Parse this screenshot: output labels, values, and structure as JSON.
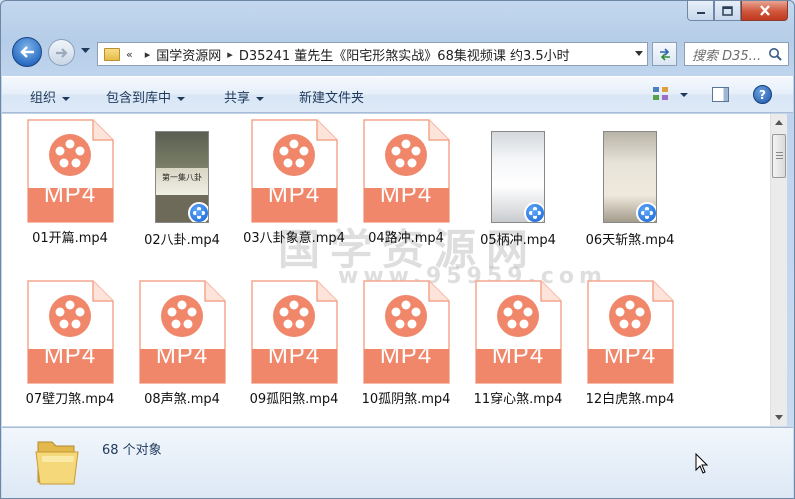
{
  "window": {
    "caption_buttons": [
      "minimize",
      "maximize",
      "close"
    ]
  },
  "address_bar": {
    "overflow": "«",
    "segments": [
      "国学资源网",
      "D35241 董先生《阳宅形煞实战》68集视频课 约3.5小时"
    ],
    "search_placeholder": "搜索 D35..."
  },
  "commands": {
    "organize": "组织",
    "include_library": "包含到库中",
    "share": "共享",
    "new_folder": "新建文件夹"
  },
  "files": [
    {
      "name": "01开篇.mp4",
      "kind": "mp4-icon"
    },
    {
      "name": "02八卦.mp4",
      "kind": "thumbnail",
      "thumb_text": "第一集八卦"
    },
    {
      "name": "03八卦象意.mp4",
      "kind": "mp4-icon"
    },
    {
      "name": "04路冲.mp4",
      "kind": "mp4-icon"
    },
    {
      "name": "05柄冲.mp4",
      "kind": "thumbnail"
    },
    {
      "name": "06天斩煞.mp4",
      "kind": "thumbnail"
    },
    {
      "name": "07壁刀煞.mp4",
      "kind": "mp4-icon"
    },
    {
      "name": "08声煞.mp4",
      "kind": "mp4-icon"
    },
    {
      "name": "09孤阳煞.mp4",
      "kind": "mp4-icon"
    },
    {
      "name": "10孤阴煞.mp4",
      "kind": "mp4-icon"
    },
    {
      "name": "11穿心煞.mp4",
      "kind": "mp4-icon"
    },
    {
      "name": "12白虎煞.mp4",
      "kind": "mp4-icon"
    }
  ],
  "icon_label": "MP4",
  "watermark": {
    "line1": "国学资源网",
    "line2": "www.95959.com"
  },
  "details": {
    "count": "68 个对象"
  },
  "colors": {
    "mp4_orange": "#f0866a",
    "mp4_light": "#f5a58d",
    "accent_blue": "#1e395b"
  }
}
